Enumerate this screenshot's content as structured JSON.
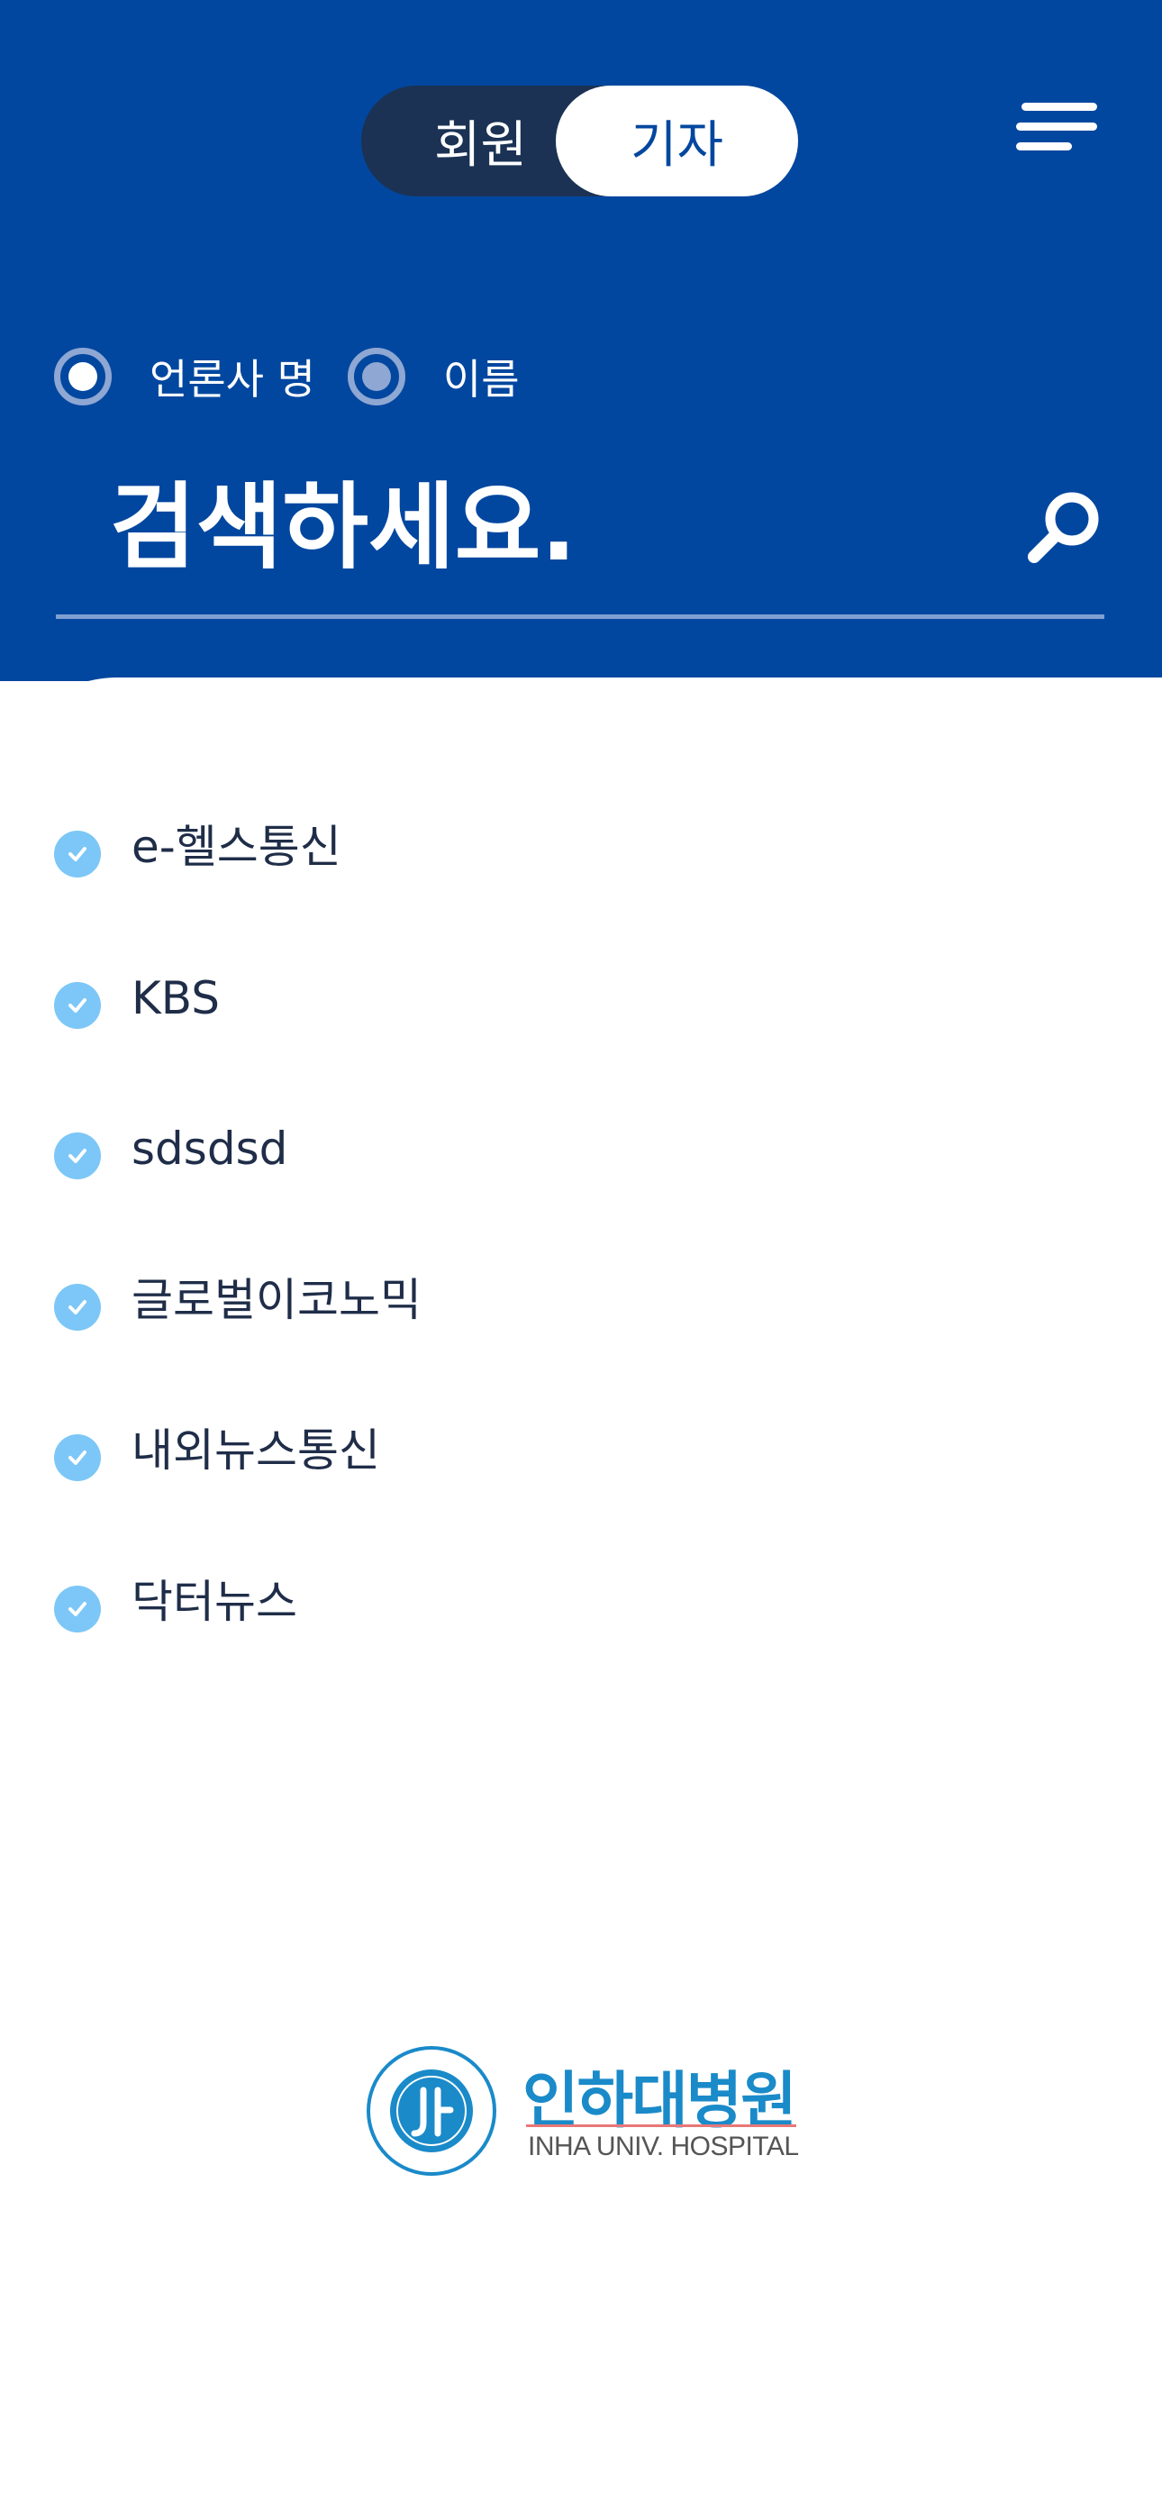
{
  "toggle": {
    "left_label": "회원",
    "right_label": "기자",
    "selected": "기자"
  },
  "search_type": {
    "options": [
      {
        "label": "언론사 명",
        "selected": true
      },
      {
        "label": "이름",
        "selected": false
      }
    ]
  },
  "search": {
    "placeholder": "검색하세요."
  },
  "results": [
    {
      "label": "e-헬스통신"
    },
    {
      "label": "KBS"
    },
    {
      "label": "sdsdsd"
    },
    {
      "label": "글로벌이코노믹"
    },
    {
      "label": "내외뉴스통신"
    },
    {
      "label": "닥터뉴스"
    }
  ],
  "footer_logo": {
    "name_ko": "인하대병원",
    "name_en": "INHA UNIV. HOSPITAL",
    "seal_text": "인 하 대 병 원 INHA UNIV. HOSPITAL"
  },
  "colors": {
    "header_bg": "#02479f",
    "toggle_bg": "#1b3254",
    "check": "#7cc7f7",
    "text_dark": "#1f2d48"
  },
  "icons": {
    "menu": "hamburger-menu-icon",
    "search": "search-magnifier-icon",
    "check": "check-circle-icon"
  }
}
